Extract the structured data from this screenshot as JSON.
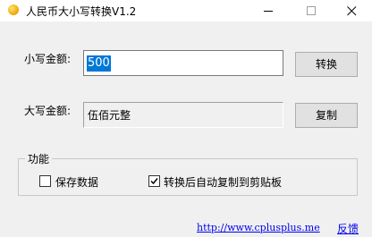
{
  "window": {
    "title": "人民币大小写转换V1.2",
    "icon": "coin-icon"
  },
  "inputs": {
    "small_label": "小写金额:",
    "small_value": "500",
    "big_label": "大写金额:",
    "big_value": "伍佰元整"
  },
  "buttons": {
    "convert": "转换",
    "copy": "复制"
  },
  "features": {
    "title": "功能",
    "save_data": {
      "label": "保存数据",
      "checked": false
    },
    "auto_copy": {
      "label": "转换后自动复制到剪贴板",
      "checked": true
    }
  },
  "footer": {
    "url": "http://www.cplusplus.me",
    "feedback": "反馈"
  },
  "colors": {
    "selection": "#0078d7",
    "link": "#0000ee",
    "window_bg": "#f0f0f0"
  }
}
